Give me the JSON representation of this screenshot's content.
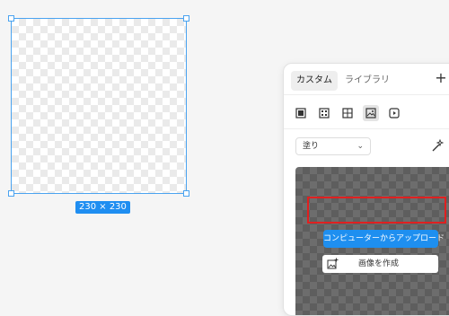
{
  "canvas": {
    "size_label": "230 × 230"
  },
  "panel": {
    "tabs": [
      {
        "label": "カスタム",
        "active": true
      },
      {
        "label": "ライブラリ",
        "active": false
      }
    ],
    "add_label": "+",
    "tool_icons": [
      {
        "name": "frame-icon",
        "active": false
      },
      {
        "name": "gradient-icon",
        "active": false
      },
      {
        "name": "pattern-icon",
        "active": false
      },
      {
        "name": "image-icon",
        "active": true
      },
      {
        "name": "video-icon",
        "active": false
      }
    ],
    "fill_select": {
      "value": "塗り",
      "chevron": "⌄"
    },
    "upload_button": "コンピューターからアップロード",
    "create_button": "画像を作成"
  },
  "colors": {
    "selection": "#4aa3f0",
    "accent": "#1e8ff0",
    "highlight_border": "#e02020"
  }
}
